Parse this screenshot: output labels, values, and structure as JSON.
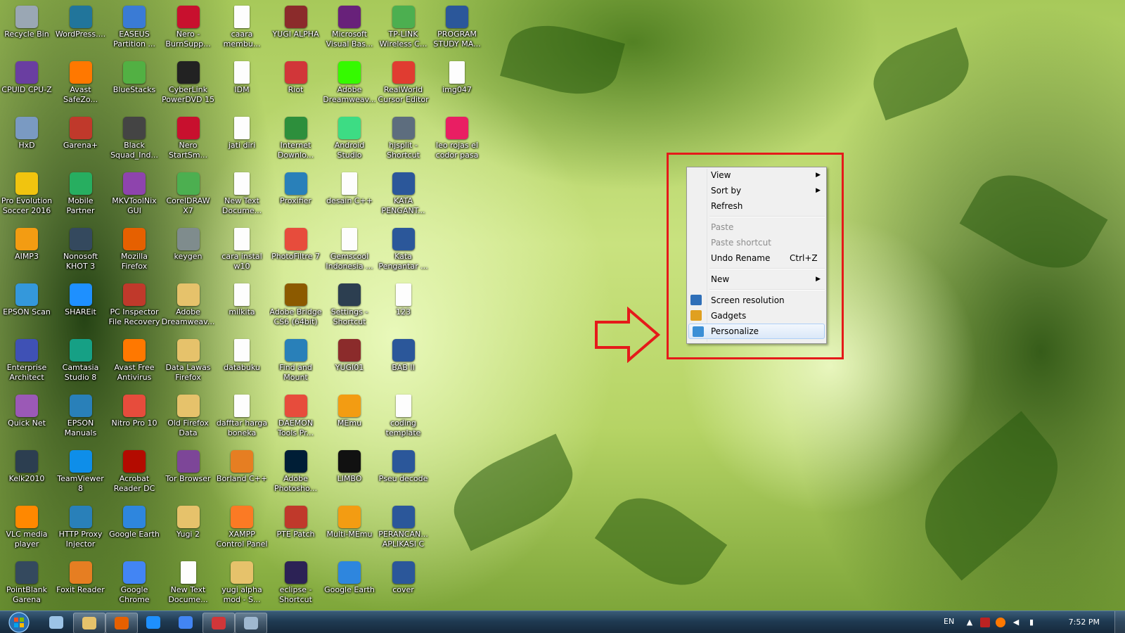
{
  "desktop": {
    "icons": [
      {
        "label": "Recycle Bin",
        "icon": "recycle-bin-icon",
        "color": "#9aa7b4"
      },
      {
        "label": "WordPress....",
        "icon": "wordpress-icon",
        "color": "#21759b"
      },
      {
        "label": "EASEUS\nPartition ...",
        "icon": "easeus-icon",
        "color": "#3a7bd5"
      },
      {
        "label": "Nero -\nBurnSupp...",
        "icon": "nero-icon",
        "color": "#c8102e"
      },
      {
        "label": "caara\nmembu...",
        "icon": "document-icon",
        "color": "#ffffff"
      },
      {
        "label": "YUGI ALPHA",
        "icon": "app-icon",
        "color": "#8b2b2b"
      },
      {
        "label": "Microsoft\nVisual Bas...",
        "icon": "visual-basic-icon",
        "color": "#68217a"
      },
      {
        "label": "TP-LINK\nWireless C...",
        "icon": "tplink-icon",
        "color": "#4caf50"
      },
      {
        "label": "PROGRAM\nSTUDY MA...",
        "icon": "word-doc-icon",
        "color": "#2b579a"
      },
      {
        "label": "CPUID CPU-Z",
        "icon": "cpuz-icon",
        "color": "#6a3ea1"
      },
      {
        "label": "Avast\nSafeZo...",
        "icon": "avast-icon",
        "color": "#ff7800"
      },
      {
        "label": "BlueStacks",
        "icon": "bluestacks-icon",
        "color": "#52b043"
      },
      {
        "label": "CyberLink\nPowerDVD 15",
        "icon": "powerdvd-icon",
        "color": "#222222"
      },
      {
        "label": "IDM",
        "icon": "document-icon",
        "color": "#ffffff"
      },
      {
        "label": "Riot",
        "icon": "riot-icon",
        "color": "#d13639"
      },
      {
        "label": "Adobe\nDreamweav...",
        "icon": "dreamweaver-icon",
        "color": "#35fa00"
      },
      {
        "label": "RealWorld\nCursor Editor",
        "icon": "cursor-editor-icon",
        "color": "#e03c31"
      },
      {
        "label": "img047",
        "icon": "document-icon",
        "color": "#ffffff"
      },
      {
        "label": "HxD",
        "icon": "hxd-icon",
        "color": "#7a9ac2"
      },
      {
        "label": "Garena+",
        "icon": "garena-icon",
        "color": "#c0392b"
      },
      {
        "label": "Black\nSquad_Ind...",
        "icon": "app-icon",
        "color": "#444444"
      },
      {
        "label": "Nero\nStartSm...",
        "icon": "nero-icon",
        "color": "#c8102e"
      },
      {
        "label": "jati diri",
        "icon": "document-icon",
        "color": "#ffffff"
      },
      {
        "label": "Internet\nDownlo...",
        "icon": "idm-icon",
        "color": "#2d8f3c"
      },
      {
        "label": "Android\nStudio",
        "icon": "android-studio-icon",
        "color": "#3ddc84"
      },
      {
        "label": "hjsplit -\nShortcut",
        "icon": "shortcut-icon",
        "color": "#5d6d7e"
      },
      {
        "label": "leo rojas el\ncodor pasa",
        "icon": "music-icon",
        "color": "#e91e63"
      },
      {
        "label": "Pro Evolution\nSoccer 2016",
        "icon": "pes-icon",
        "color": "#f1c40f"
      },
      {
        "label": "Mobile\nPartner",
        "icon": "mobile-partner-icon",
        "color": "#27ae60"
      },
      {
        "label": "MKVToolNix\nGUI",
        "icon": "mkvtoolnix-icon",
        "color": "#8e44ad"
      },
      {
        "label": "CorelDRAW\nX7",
        "icon": "coreldraw-icon",
        "color": "#4caf50"
      },
      {
        "label": "New Text\nDocume...",
        "icon": "document-icon",
        "color": "#ffffff"
      },
      {
        "label": "Proxifier",
        "icon": "proxifier-icon",
        "color": "#2980b9"
      },
      {
        "label": "desain C++",
        "icon": "document-icon",
        "color": "#ffffff"
      },
      {
        "label": "KATA\nPENGANT...",
        "icon": "word-doc-icon",
        "color": "#2b579a"
      },
      {
        "label": "AIMP3",
        "icon": "aimp-icon",
        "color": "#f39c12"
      },
      {
        "label": "Nonosoft\nKHOT 3",
        "icon": "app-icon",
        "color": "#34495e"
      },
      {
        "label": "Mozilla\nFirefox",
        "icon": "firefox-icon",
        "color": "#e66000"
      },
      {
        "label": "keygen",
        "icon": "keygen-icon",
        "color": "#7f8c8d"
      },
      {
        "label": "cara instal\nw10",
        "icon": "document-icon",
        "color": "#ffffff"
      },
      {
        "label": "PhotoFiltre 7",
        "icon": "photofiltre-icon",
        "color": "#e74c3c"
      },
      {
        "label": "Gemscool\nIndonesia ...",
        "icon": "document-icon",
        "color": "#ffffff"
      },
      {
        "label": "Kata\nPengantar ...",
        "icon": "word-doc-icon",
        "color": "#2b579a"
      },
      {
        "label": "EPSON Scan",
        "icon": "epson-scan-icon",
        "color": "#3498db"
      },
      {
        "label": "SHAREit",
        "icon": "shareit-icon",
        "color": "#1e90ff"
      },
      {
        "label": "PC Inspector\nFile Recovery",
        "icon": "pc-inspector-icon",
        "color": "#c0392b"
      },
      {
        "label": "Adobe\nDreamweav...",
        "icon": "folder-icon",
        "color": "#e6c26b"
      },
      {
        "label": "milkita",
        "icon": "document-icon",
        "color": "#ffffff"
      },
      {
        "label": "Adobe Bridge\nCS6 (64bit)",
        "icon": "bridge-icon",
        "color": "#8c5a00"
      },
      {
        "label": "Settings -\nShortcut",
        "icon": "settings-icon",
        "color": "#2c3e50"
      },
      {
        "label": "123",
        "icon": "document-icon",
        "color": "#ffffff"
      },
      {
        "label": "Enterprise\nArchitect",
        "icon": "enterprise-architect-icon",
        "color": "#3f51b5"
      },
      {
        "label": "Camtasia\nStudio 8",
        "icon": "camtasia-icon",
        "color": "#16a085"
      },
      {
        "label": "Avast Free\nAntivirus",
        "icon": "avast-icon",
        "color": "#ff7800"
      },
      {
        "label": "Data Lawas\nFirefox",
        "icon": "folder-icon",
        "color": "#e6c26b"
      },
      {
        "label": "databuku",
        "icon": "document-icon",
        "color": "#ffffff"
      },
      {
        "label": "Find and\nMount",
        "icon": "find-mount-icon",
        "color": "#2980b9"
      },
      {
        "label": "YUGI01",
        "icon": "app-icon",
        "color": "#8b2b2b"
      },
      {
        "label": "BAB II",
        "icon": "word-doc-icon",
        "color": "#2b579a"
      },
      {
        "label": "Quick Net",
        "icon": "quick-net-icon",
        "color": "#9b59b6"
      },
      {
        "label": "EPSON\nManuals",
        "icon": "epson-manuals-icon",
        "color": "#2980b9"
      },
      {
        "label": "Nitro Pro 10",
        "icon": "nitro-icon",
        "color": "#e74c3c"
      },
      {
        "label": "Old Firefox\nData",
        "icon": "folder-icon",
        "color": "#e6c26b"
      },
      {
        "label": "dafftar harga\nboneka",
        "icon": "document-icon",
        "color": "#ffffff"
      },
      {
        "label": "DAEMON\nTools Pr...",
        "icon": "daemon-tools-icon",
        "color": "#e74c3c"
      },
      {
        "label": "MEmu",
        "icon": "memu-icon",
        "color": "#f39c12"
      },
      {
        "label": "coding\ntemplate",
        "icon": "document-icon",
        "color": "#ffffff"
      },
      {
        "label": "Kelk2010",
        "icon": "kelk-icon",
        "color": "#2c3e50"
      },
      {
        "label": "TeamViewer\n8",
        "icon": "teamviewer-icon",
        "color": "#0e8ee9"
      },
      {
        "label": "Acrobat\nReader DC",
        "icon": "acrobat-icon",
        "color": "#b30b00"
      },
      {
        "label": "Tor Browser",
        "icon": "tor-browser-icon",
        "color": "#7d4698"
      },
      {
        "label": "Borland C++",
        "icon": "borland-icon",
        "color": "#e67e22"
      },
      {
        "label": "Adobe\nPhotosho...",
        "icon": "photoshop-icon",
        "color": "#001e36"
      },
      {
        "label": "LIMBO",
        "icon": "limbo-icon",
        "color": "#111111"
      },
      {
        "label": "Pseu decode",
        "icon": "word-doc-icon",
        "color": "#2b579a"
      },
      {
        "label": "VLC media\nplayer",
        "icon": "vlc-icon",
        "color": "#ff8800"
      },
      {
        "label": "HTTP Proxy\nInjector",
        "icon": "http-injector-icon",
        "color": "#2980b9"
      },
      {
        "label": "Google Earth",
        "icon": "google-earth-icon",
        "color": "#2e86de"
      },
      {
        "label": "Yugi 2",
        "icon": "folder-icon",
        "color": "#e6c26b"
      },
      {
        "label": "XAMPP\nControl Panel",
        "icon": "xampp-icon",
        "color": "#fb7a24"
      },
      {
        "label": "PTE Patch",
        "icon": "pte-patch-icon",
        "color": "#c0392b"
      },
      {
        "label": "Multi-MEmu",
        "icon": "memu-icon",
        "color": "#f39c12"
      },
      {
        "label": "PERANCAN...\nAPLIKASI C",
        "icon": "word-doc-icon",
        "color": "#2b579a"
      },
      {
        "label": "PointBlank\nGarena",
        "icon": "pointblank-icon",
        "color": "#34495e"
      },
      {
        "label": "Foxit Reader",
        "icon": "foxit-icon",
        "color": "#e67e22"
      },
      {
        "label": "Google\nChrome",
        "icon": "chrome-icon",
        "color": "#4285f4"
      },
      {
        "label": "New Text\nDocume...",
        "icon": "document-icon",
        "color": "#ffffff"
      },
      {
        "label": "yugi alpha\nmod - S...",
        "icon": "folder-icon",
        "color": "#e6c26b"
      },
      {
        "label": "eclipse -\nShortcut",
        "icon": "eclipse-icon",
        "color": "#2c2255"
      },
      {
        "label": "Google Earth",
        "icon": "google-earth-icon",
        "color": "#2e86de"
      },
      {
        "label": "cover",
        "icon": "word-doc-icon",
        "color": "#2b579a"
      }
    ],
    "columns_per_row": [
      9,
      9,
      9,
      8,
      8,
      8,
      8,
      8,
      8,
      8,
      8
    ],
    "context_menu": {
      "items": [
        {
          "label": "View",
          "submenu": true
        },
        {
          "label": "Sort by",
          "submenu": true
        },
        {
          "label": "Refresh"
        },
        {
          "separator": true
        },
        {
          "label": "Paste",
          "disabled": true
        },
        {
          "label": "Paste shortcut",
          "disabled": true
        },
        {
          "label": "Undo Rename",
          "shortcut": "Ctrl+Z"
        },
        {
          "separator": true
        },
        {
          "label": "New",
          "submenu": true
        },
        {
          "separator": true
        },
        {
          "label": "Screen resolution",
          "icon": "screen-resolution-icon"
        },
        {
          "label": "Gadgets",
          "icon": "gadgets-icon"
        },
        {
          "label": "Personalize",
          "icon": "personalize-icon",
          "highlighted": true
        }
      ]
    },
    "annotation_color": "#e51a1a"
  },
  "taskbar": {
    "pinned": [
      {
        "icon": "windows-explorer-icon",
        "color": "#9cc3e6"
      },
      {
        "icon": "file-explorer-icon",
        "color": "#e6c26b",
        "active": true
      },
      {
        "icon": "firefox-icon",
        "color": "#e66000",
        "active": true
      },
      {
        "icon": "internet-explorer-icon",
        "color": "#1e90ff"
      },
      {
        "icon": "chrome-icon",
        "color": "#4285f4"
      },
      {
        "icon": "riot-icon",
        "color": "#d13639",
        "active": true
      },
      {
        "icon": "find-mount-icon",
        "color": "#9fb8d0",
        "active": true
      }
    ],
    "language": "EN",
    "clock": "7:52 PM"
  }
}
